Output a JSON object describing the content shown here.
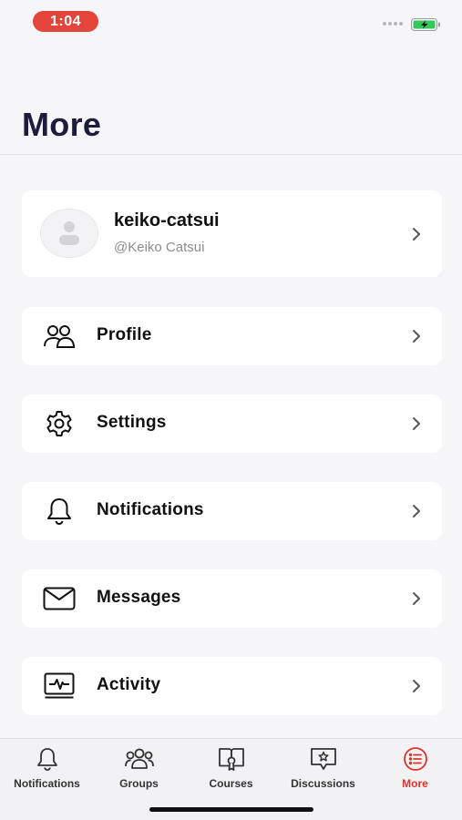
{
  "status_bar": {
    "time": "1:04"
  },
  "header": {
    "title": "More"
  },
  "user_card": {
    "username": "keiko-catsui",
    "handle": "@Keiko Catsui"
  },
  "menu": {
    "items": [
      {
        "label": "Profile",
        "icon": "users-icon"
      },
      {
        "label": "Settings",
        "icon": "gear-icon"
      },
      {
        "label": "Notifications",
        "icon": "bell-icon"
      },
      {
        "label": "Messages",
        "icon": "envelope-icon"
      },
      {
        "label": "Activity",
        "icon": "activity-icon"
      }
    ]
  },
  "tab_bar": {
    "tabs": [
      {
        "label": "Notifications",
        "icon": "bell-icon",
        "active": false
      },
      {
        "label": "Groups",
        "icon": "groups-icon",
        "active": false
      },
      {
        "label": "Courses",
        "icon": "book-icon",
        "active": false
      },
      {
        "label": "Discussions",
        "icon": "chat-star-icon",
        "active": false
      },
      {
        "label": "More",
        "icon": "list-circle-icon",
        "active": true
      }
    ]
  },
  "colors": {
    "accent": "#d8342c",
    "title": "#1d1c3e",
    "background": "#f6f6f8",
    "time_pill": "#e5443b",
    "battery_fill": "#35c759"
  }
}
